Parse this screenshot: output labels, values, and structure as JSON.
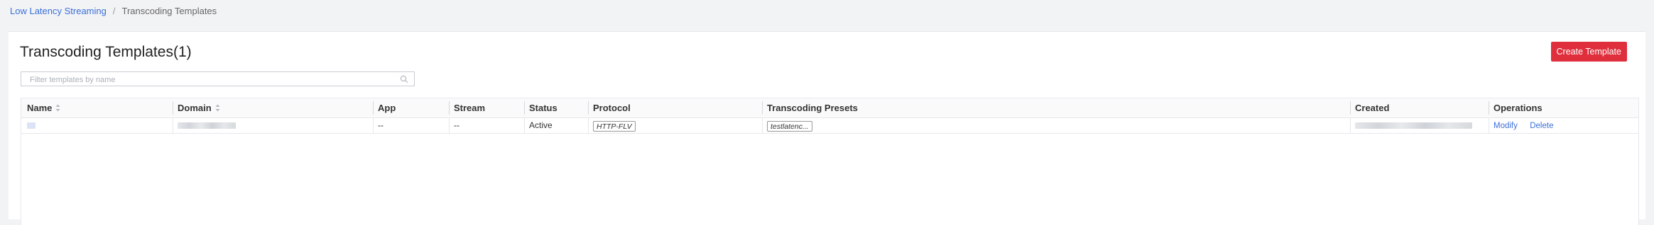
{
  "breadcrumb": {
    "parent": "Low Latency Streaming",
    "separator": "/",
    "current": "Transcoding Templates"
  },
  "page": {
    "title": "Transcoding Templates(1)",
    "create_button": "Create Template"
  },
  "search": {
    "placeholder": "Filter templates by name",
    "value": "",
    "icon": "search-icon"
  },
  "table": {
    "columns": [
      "Name",
      "Domain",
      "App",
      "Stream",
      "Status",
      "Protocol",
      "Transcoding Presets",
      "Created",
      "Operations"
    ],
    "sortable_columns": [
      "Name",
      "Domain"
    ],
    "rows": [
      {
        "app": "--",
        "stream": "--",
        "status": "Active",
        "protocol": "HTTP-FLV",
        "preset": "testlatenc...",
        "operations": {
          "modify": "Modify",
          "delete": "Delete"
        }
      }
    ]
  },
  "colors": {
    "accent_link": "#3b6fd8",
    "primary_button": "#df2f3d",
    "page_background": "#f2f3f5"
  }
}
